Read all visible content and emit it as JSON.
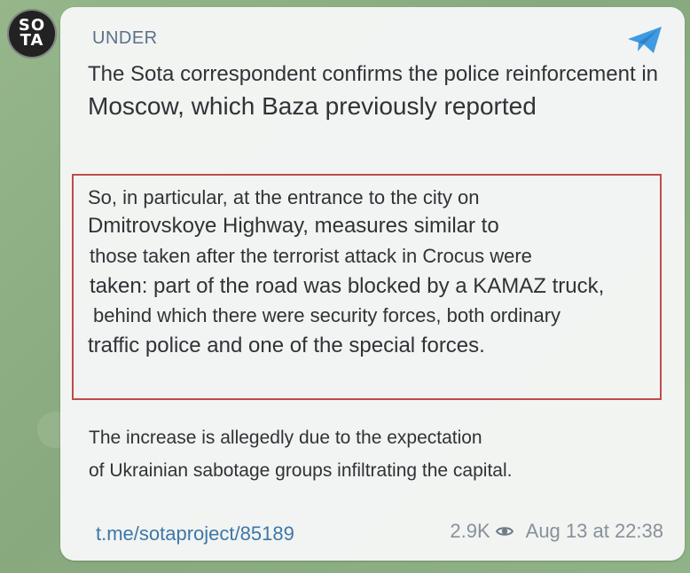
{
  "channel": {
    "avatar_top": "SO",
    "avatar_bottom": "TA",
    "name": "UNDER"
  },
  "message": {
    "paragraph1": [
      "The Sota correspondent confirms the police reinforcement in",
      "Moscow, which Baza previously reported"
    ],
    "paragraph2": [
      "So, in particular, at the entrance to the city on",
      "Dmitrovskoye Highway, measures similar to",
      "those taken after the terrorist attack in Crocus were",
      "taken: part of the road was blocked by a KAMAZ truck,",
      "behind which there were security forces, both ordinary",
      "traffic police and one of the special forces."
    ],
    "paragraph3": [
      "The increase is allegedly due to the expectation",
      "of Ukrainian sabotage groups infiltrating the capital."
    ]
  },
  "footer": {
    "link": "t.me/sotaproject/85189",
    "views": "2.9K",
    "timestamp": "Aug 13 at 22:38"
  },
  "colors": {
    "background": "#8fb186",
    "bubble": "#f6f7f7",
    "link": "#3e77a8",
    "highlight_border": "#bf4b4b",
    "telegram_blue": "#3f9ae2"
  },
  "icons": {
    "send": "telegram-send-icon",
    "views": "eye-icon"
  }
}
